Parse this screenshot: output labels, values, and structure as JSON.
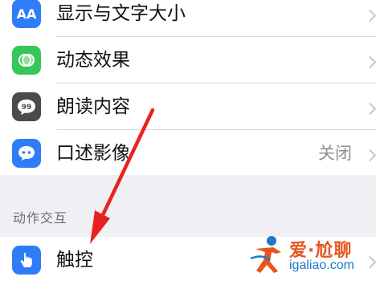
{
  "settings": {
    "rows": [
      {
        "label": "显示与文字大小",
        "icon": "text-size-icon",
        "color": "#2f7df6"
      },
      {
        "label": "动态效果",
        "icon": "motion-icon",
        "color": "#35c759"
      },
      {
        "label": "朗读内容",
        "icon": "spoken-content-icon",
        "color": "#4a4a4f"
      },
      {
        "label": "口述影像",
        "value": "关闭",
        "icon": "audio-description-icon",
        "color": "#2f7df6"
      }
    ],
    "section_header": "动作交互",
    "touch_row": {
      "label": "触控",
      "icon": "touch-icon",
      "color": "#2f7df6"
    }
  },
  "icons": {
    "text_size_glyph": "AA",
    "spoken_glyph": "99"
  },
  "watermark": {
    "text": "爱·尬聊",
    "url": "igaliao.com",
    "colors": {
      "text": "#e8541e",
      "url": "#1f78c8"
    }
  },
  "annotation": {
    "type": "red-arrow",
    "color": "#e8231f",
    "points_to": "触控"
  }
}
